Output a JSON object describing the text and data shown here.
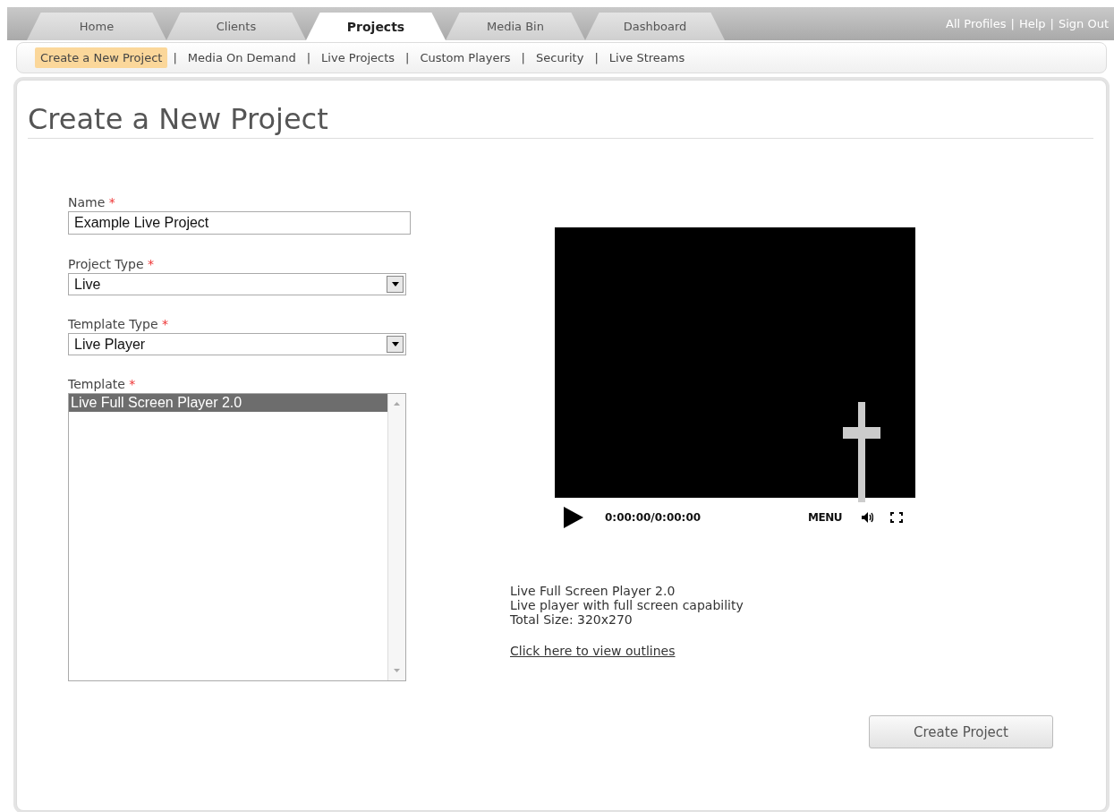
{
  "tabs": [
    {
      "label": "Home",
      "selected": false
    },
    {
      "label": "Clients",
      "selected": false
    },
    {
      "label": "Projects",
      "selected": true
    },
    {
      "label": "Media Bin",
      "selected": false
    },
    {
      "label": "Dashboard",
      "selected": false
    }
  ],
  "account_links": [
    "All Profiles",
    "Help",
    "Sign Out"
  ],
  "account_separators": [
    "|",
    "|"
  ],
  "subnav_separators": [
    "|",
    "|",
    "|",
    "|",
    "|"
  ],
  "subnav": [
    {
      "label": "Create a New Project",
      "selected": true
    },
    {
      "label": "Media On Demand",
      "selected": false
    },
    {
      "label": "Live Projects",
      "selected": false
    },
    {
      "label": "Custom Players",
      "selected": false
    },
    {
      "label": "Security",
      "selected": false
    },
    {
      "label": "Live Streams",
      "selected": false
    }
  ],
  "page_title": "Create a New Project",
  "form": {
    "name": {
      "label": "Name",
      "required_mark": "*",
      "value": "Example Live Project"
    },
    "project_type": {
      "label": "Project Type",
      "required_mark": "*",
      "value": "Live"
    },
    "template_type": {
      "label": "Template Type",
      "required_mark": "*",
      "value": "Live Player"
    },
    "template": {
      "label": "Template",
      "required_mark": "*",
      "options": [
        {
          "label": "Live Full Screen Player 2.0",
          "selected": true
        }
      ]
    }
  },
  "player": {
    "time": "0:00:00/0:00:00",
    "menu": "MENU"
  },
  "template_info": {
    "lines": [
      "Live Full Screen Player 2.0",
      "Live player with full screen capability",
      "Total Size: 320x270"
    ],
    "link": "Click here to view outlines"
  },
  "create_button": "Create Project"
}
